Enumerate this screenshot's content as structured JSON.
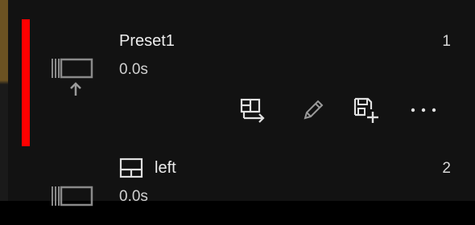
{
  "presets": [
    {
      "title": "Preset1",
      "duration": "0.0s",
      "number": "1",
      "icon": "preset-thumbnail-up-icon",
      "selected": true,
      "actions": [
        {
          "name": "apply-preset-button",
          "icon": "apply-layout-icon"
        },
        {
          "name": "edit-preset-button",
          "icon": "pencil-icon"
        },
        {
          "name": "save-as-preset-button",
          "icon": "save-plus-icon"
        },
        {
          "name": "more-options-button",
          "icon": "ellipsis-icon"
        }
      ]
    },
    {
      "title": "left",
      "duration": "0.0s",
      "number": "2",
      "icon": "preset-thumbnail-icon",
      "title_icon": "split-layout-icon",
      "selected": false
    }
  ],
  "colors": {
    "selection": "#ff0000",
    "background": "#121212",
    "edge": "#6b5222",
    "text": "#ededed"
  }
}
